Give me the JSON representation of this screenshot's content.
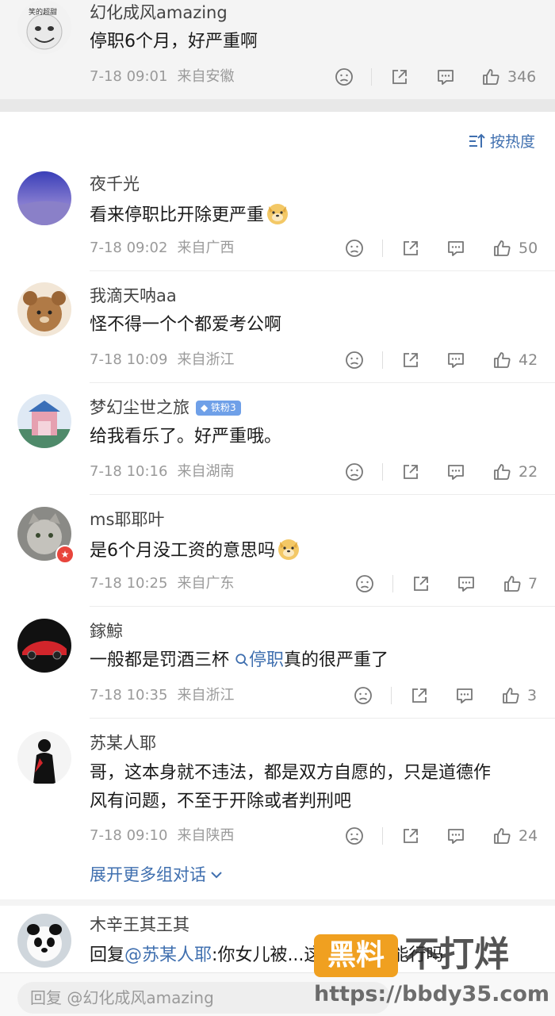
{
  "top_comment": {
    "avatar_text": "笑的超甜",
    "username": "幻化成风amazing",
    "text": "停职6个月，好严重啊",
    "time": "7-18 09:01",
    "location": "来自安徽",
    "likes": "346"
  },
  "sort_label": "按热度",
  "replies": [
    {
      "username": "夜千光",
      "text": "看来停职比开除更严重",
      "emoji": "doge-emoji",
      "time": "7-18 09:02",
      "location": "来自广西",
      "likes": "50"
    },
    {
      "username": "我滴天呐aa",
      "text": "怪不得一个个都爱考公啊",
      "time": "7-18 10:09",
      "location": "来自浙江",
      "likes": "42"
    },
    {
      "username": "梦幻尘世之旅",
      "badge": "铁粉3",
      "text": "给我看乐了。好严重哦。",
      "time": "7-18 10:16",
      "location": "来自湖南",
      "likes": "22"
    },
    {
      "username": "ms耶耶叶",
      "text": "是6个月没工资的意思吗",
      "emoji": "doge-emoji",
      "time": "7-18 10:25",
      "location": "来自广东",
      "likes": "7"
    },
    {
      "username": "鎵鯨",
      "text_before": "一般都是罚酒三杯 ",
      "topic": "停职",
      "text_after": "真的很严重了",
      "time": "7-18 10:35",
      "location": "来自浙江",
      "likes": "3"
    },
    {
      "username": "苏某人耶",
      "text_line1": "哥，这本身就不违法，都是双方自愿的，只是道德作",
      "text_line2": "风有问题，不至于开除或者判刑吧",
      "time": "7-18 09:10",
      "location": "来自陕西",
      "likes": "24"
    }
  ],
  "expand_label": "展开更多组对话",
  "last_reply": {
    "username": "木辛王其王其",
    "prefix": "回复",
    "mention": "@苏某人耶",
    "text": ":你女儿被...这样对待你能行吗"
  },
  "reply_placeholder": "回复 @幻化成风amazing",
  "watermark": {
    "box_text": "黑料",
    "big_text": "不打烊",
    "url": "https://bbdy35.com"
  },
  "colors": {
    "link": "#3f6faf",
    "meta": "#9a9a9a",
    "watermark": "#f0a020"
  }
}
